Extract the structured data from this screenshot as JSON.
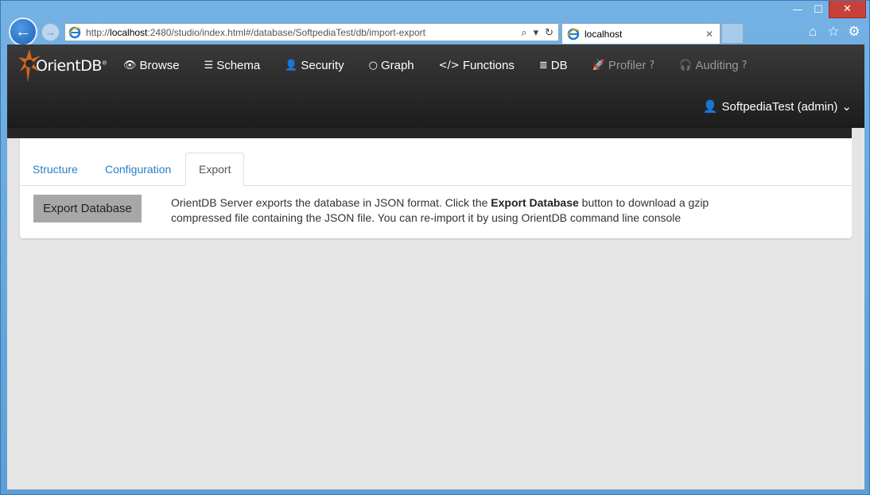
{
  "window": {
    "min_label": "—",
    "max_label": "☐",
    "close_label": "✕"
  },
  "browser": {
    "back_glyph": "←",
    "forward_glyph": "→",
    "url_prefix": "http://",
    "url_host": "localhost",
    "url_rest": ":2480/studio/index.html#/database/SoftpediaTest/db/import-export",
    "search_glyph": "⌕",
    "dropdown_glyph": "▾",
    "refresh_glyph": "↻",
    "tab_title": "localhost",
    "tab_close": "✕",
    "home_icon": "⌂",
    "favorites_icon": "☆",
    "settings_icon": "⚙"
  },
  "app": {
    "logo_text": "OrientDB",
    "logo_sup": "®",
    "menu": [
      {
        "icon": "👁",
        "label": "Browse",
        "muted": false
      },
      {
        "icon": "☰",
        "label": "Schema",
        "muted": false
      },
      {
        "icon": "👤",
        "label": "Security",
        "muted": false
      },
      {
        "icon": "○",
        "label": "Graph",
        "muted": false
      },
      {
        "icon": "</>",
        "label": "Functions",
        "muted": false
      },
      {
        "icon": "≣",
        "label": "DB",
        "muted": false
      },
      {
        "icon": "🚀",
        "label": "Profiler",
        "muted": true
      },
      {
        "icon": "🎧",
        "label": "Auditing",
        "muted": true
      }
    ],
    "help_glyph": "?",
    "user": {
      "icon": "👤",
      "label": "SoftpediaTest (admin)",
      "caret": "⌄"
    }
  },
  "tabs": [
    "Structure",
    "Configuration",
    "Export"
  ],
  "active_tab": "Export",
  "export": {
    "button_label": "Export Database",
    "desc_part1": "OrientDB Server exports the database in JSON format. Click the ",
    "desc_bold": "Export Database",
    "desc_part2": " button to download a gzip compressed file containing the JSON file. You can re-import it by using OrientDB command line console"
  }
}
